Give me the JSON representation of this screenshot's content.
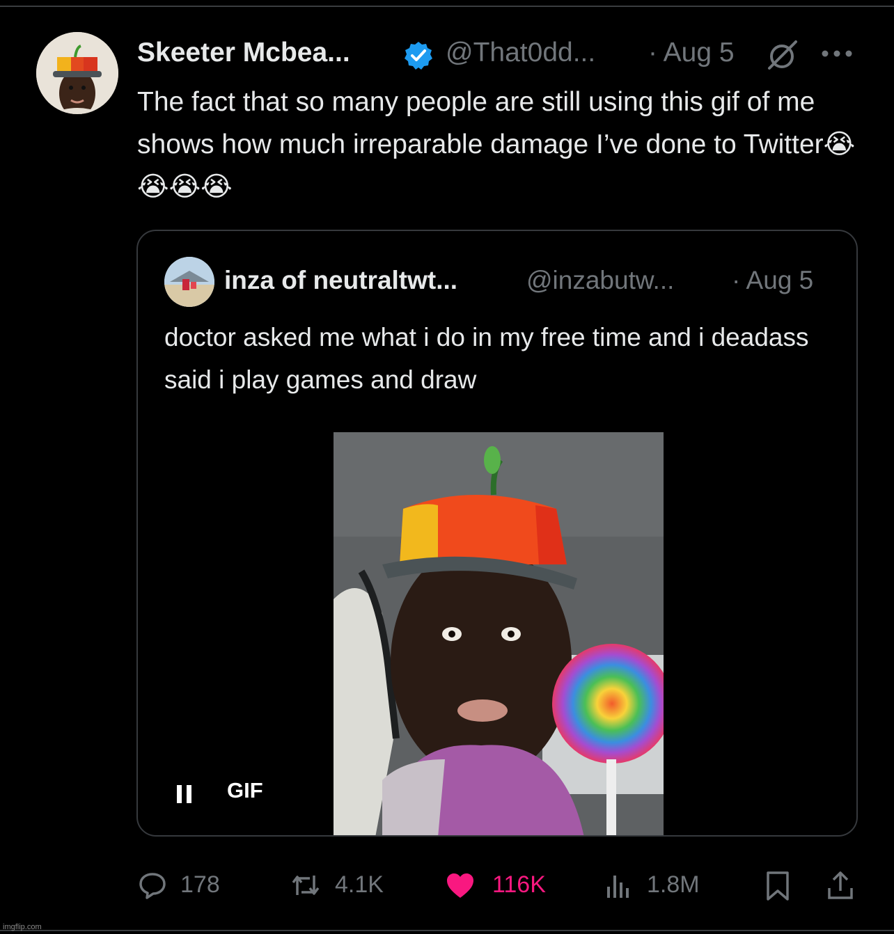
{
  "tweet": {
    "author_name": "Skeeter Mcbea...",
    "author_handle": "@That0dd...",
    "date": "· Aug 5",
    "text": "The fact that so many people are still using this gif of me shows how much irreparable damage I’ve done to Twitter😭😭😭😭"
  },
  "quoted_tweet": {
    "author_name": "inza of neutraltwt...",
    "author_handle": "@inzabutw...",
    "date": "· Aug 5",
    "text": "doctor asked me what i do in my free time and i deadass said i play games and draw",
    "media_badge": "GIF"
  },
  "actions": {
    "replies": "178",
    "retweets": "4.1K",
    "likes": "116K",
    "views": "1.8M"
  },
  "watermark": "imgflip.com",
  "colors": {
    "background": "#000000",
    "text": "#e7e9ea",
    "muted": "#71767b",
    "verified": "#1d9bf0",
    "like": "#f91880",
    "border": "#36393d"
  },
  "icons": [
    "verified-badge-icon",
    "grok-icon",
    "more-icon",
    "pause-icon",
    "reply-icon",
    "retweet-icon",
    "like-icon",
    "views-icon",
    "bookmark-icon",
    "share-icon"
  ]
}
